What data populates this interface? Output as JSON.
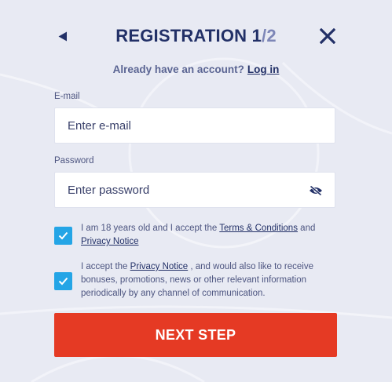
{
  "header": {
    "title_main": "REGISTRATION",
    "step_current": "1",
    "step_separator": "/",
    "step_total": "2",
    "back_icon": "back-arrow-icon",
    "close_icon": "close-icon"
  },
  "login_prompt": {
    "text": "Already have an account?",
    "link_label": "Log in"
  },
  "email": {
    "label": "E-mail",
    "placeholder": "Enter e-mail",
    "value": ""
  },
  "password": {
    "label": "Password",
    "placeholder": "Enter password",
    "value": "",
    "toggle_icon": "eye-slash-icon"
  },
  "age_consent": {
    "checked": true,
    "text_before": "I am 18 years old and I accept the",
    "terms_link": "Terms & Conditions",
    "text_middle": "and",
    "privacy_link": "Privacy Notice"
  },
  "marketing_consent": {
    "checked": true,
    "text_before": "I accept the",
    "privacy_link": "Privacy Notice",
    "text_after": ", and would also like to receive bonuses, promotions, news or other relevant information periodically by any channel of communication."
  },
  "submit": {
    "label": "NEXT STEP"
  },
  "colors": {
    "background": "#e8eaf3",
    "title": "#223067",
    "accent_checkbox": "#24a5e6",
    "primary_button": "#e53a24"
  }
}
